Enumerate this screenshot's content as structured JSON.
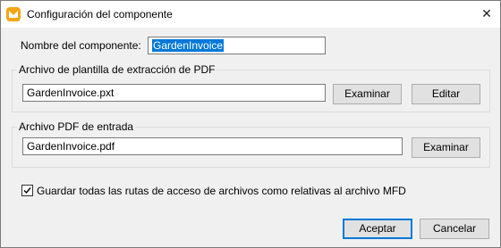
{
  "window": {
    "title": "Configuración del componente",
    "close_glyph": "✕"
  },
  "component_name": {
    "label": "Nombre del componente:",
    "value": "GardenInvoice"
  },
  "template_group": {
    "title": "Archivo de plantilla de extracción de PDF",
    "path": "GardenInvoice.pxt",
    "browse_label": "Examinar",
    "edit_label": "Editar"
  },
  "input_group": {
    "title": "Archivo PDF de entrada",
    "path": "GardenInvoice.pdf",
    "browse_label": "Examinar"
  },
  "relative_paths": {
    "label": "Guardar todas las rutas de acceso de archivos como relativas al archivo MFD",
    "checked": true
  },
  "footer": {
    "ok_label": "Aceptar",
    "cancel_label": "Cancelar"
  },
  "colors": {
    "accent": "#0078d7",
    "app_icon": "#f2a516"
  }
}
